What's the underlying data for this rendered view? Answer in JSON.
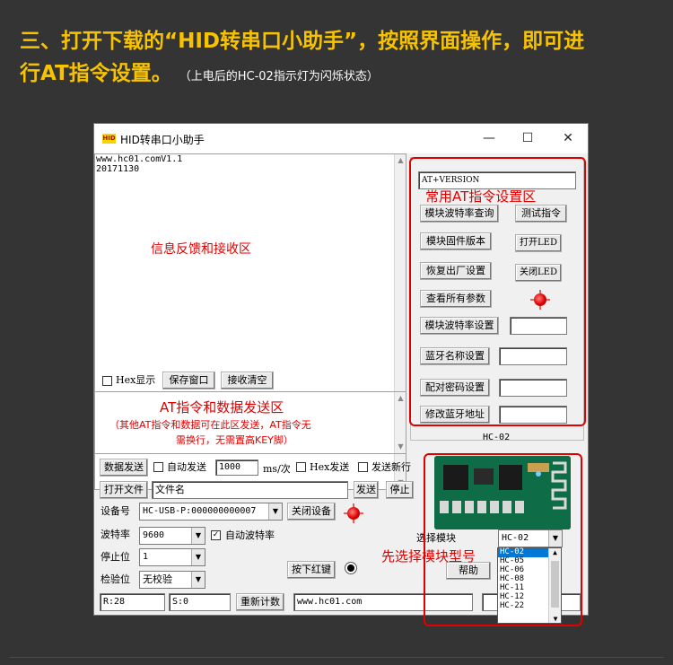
{
  "heading": {
    "line1": "三、打开下载的“HID转串口小助手”，按照界面操作，即可进",
    "line2": "行AT指令设置。",
    "note": "（上电后的HC-02指示灯为闪烁状态）"
  },
  "window": {
    "icon_text": "HID",
    "title": "HID转串口小助手",
    "min": "—",
    "max": "☐",
    "close": "✕"
  },
  "receive": {
    "lines": [
      "www.hc01.comV1.1",
      "20171130"
    ],
    "annotation": "信息反馈和接收区"
  },
  "bottom_bar": {
    "hex_display": "Hex显示",
    "save_window": "保存窗口",
    "clear_receive": "接收清空"
  },
  "send": {
    "annotation_title": "AT指令和数据发送区",
    "annotation_note_1": "（其他AT指令和数据可在此区发送，AT指令无",
    "annotation_note_2": "需换行，无需置高KEY脚）"
  },
  "controls": {
    "send_data": "数据发送",
    "auto_send": "自动发送",
    "interval": "1000",
    "interval_unit": "ms/次",
    "hex_send": "Hex发送",
    "send_newline": "发送新行",
    "open_file": "打开文件",
    "file_name": "文件名",
    "send": "发送",
    "stop": "停止",
    "device_label": "设备号",
    "device_value": "HC-USB-P:000000000007",
    "close_device": "关闭设备",
    "baud_label": "波特率",
    "baud_value": "9600",
    "auto_baud": "自动波特率",
    "stopbit_label": "停止位",
    "stopbit_value": "1",
    "parity_label": "检验位",
    "parity_value": "无校验",
    "press_red_key": "按下红键",
    "r_count": "R:28",
    "s_count": "S:0",
    "recount": "重新计数",
    "url": "www.hc01.com"
  },
  "at_panel": {
    "at_input": "AT+VERSION",
    "annotation": "常用AT指令设置区",
    "query_baud": "模块波特率查询",
    "test_cmd": "测试指令",
    "firmware": "模块固件版本",
    "led_on": "打开LED",
    "factory_reset": "恢复出厂设置",
    "led_off": "关闭LED",
    "view_params": "查看所有参数",
    "set_baud": "模块波特率设置",
    "set_bt_name": "蓝牙名称设置",
    "set_pair_code": "配对密码设置",
    "set_bt_addr": "修改蓝牙地址",
    "module_name": "HC-02"
  },
  "module": {
    "select_label": "选择模块",
    "selected": "HC-02",
    "help": "帮助",
    "annotation": "先选择模块型号",
    "options": [
      "HC-02",
      "HC-05",
      "HC-06",
      "HC-08",
      "HC-11",
      "HC-12",
      "HC-22"
    ]
  },
  "colors": {
    "heading": "#f7c300",
    "annotation_red": "#e00000",
    "background": "#343434"
  }
}
